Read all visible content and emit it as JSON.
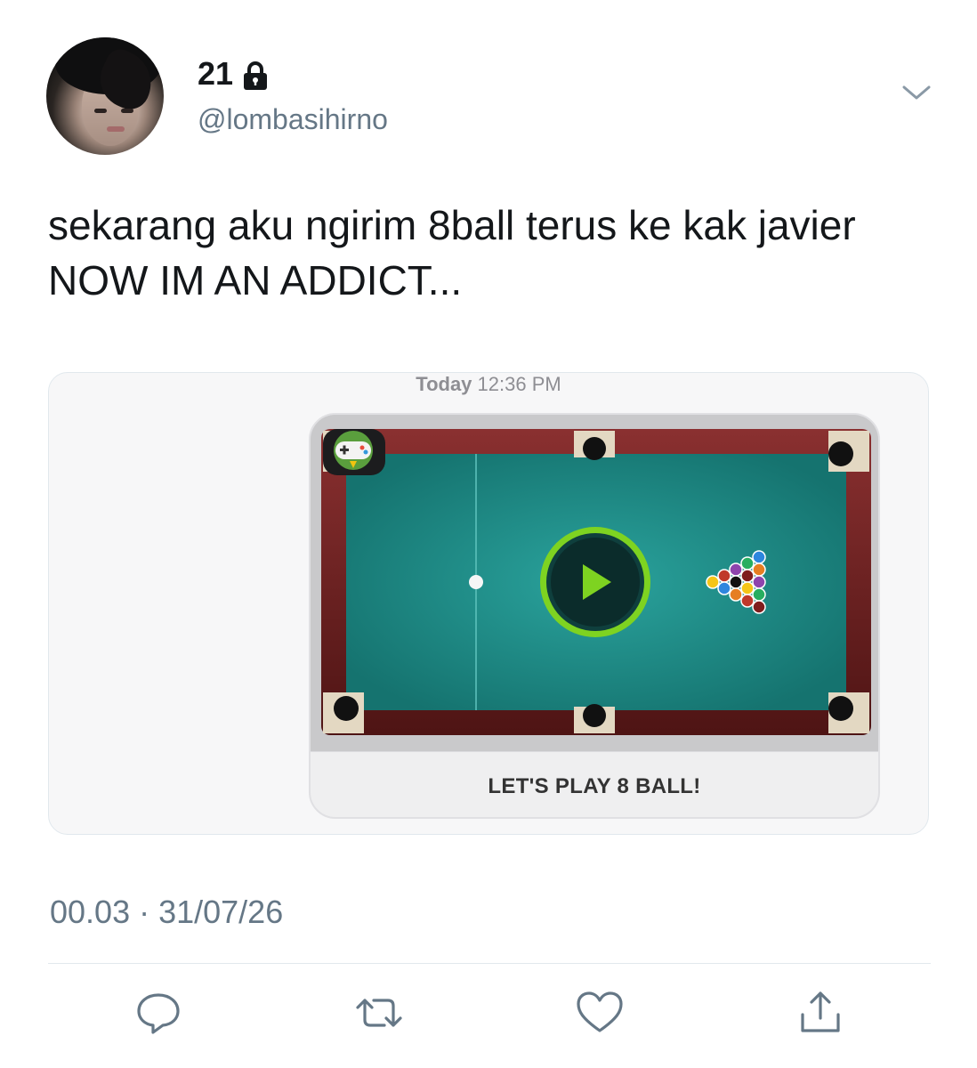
{
  "tweet": {
    "display_name": "21",
    "handle": "@lombasihirno",
    "text": "sekarang aku ngirim 8ball terus ke kak javier NOW IM AN ADDICT...",
    "timestamp": "00.03 · 31/07/26",
    "protected": true
  },
  "media": {
    "message_time_day": "Today",
    "message_time_clock": "12:36 PM",
    "caption": "LET'S PLAY 8 BALL!"
  },
  "icons": {
    "lock": "lock-icon",
    "menu": "chevron-down-icon",
    "reply": "reply-icon",
    "retweet": "retweet-icon",
    "like": "heart-icon",
    "share": "share-icon",
    "play": "play-icon"
  },
  "colors": {
    "text": "#14171a",
    "secondary": "#657786",
    "felt": "#1e8a86",
    "rail": "#6b1f1f",
    "play_accent": "#7ed321"
  }
}
